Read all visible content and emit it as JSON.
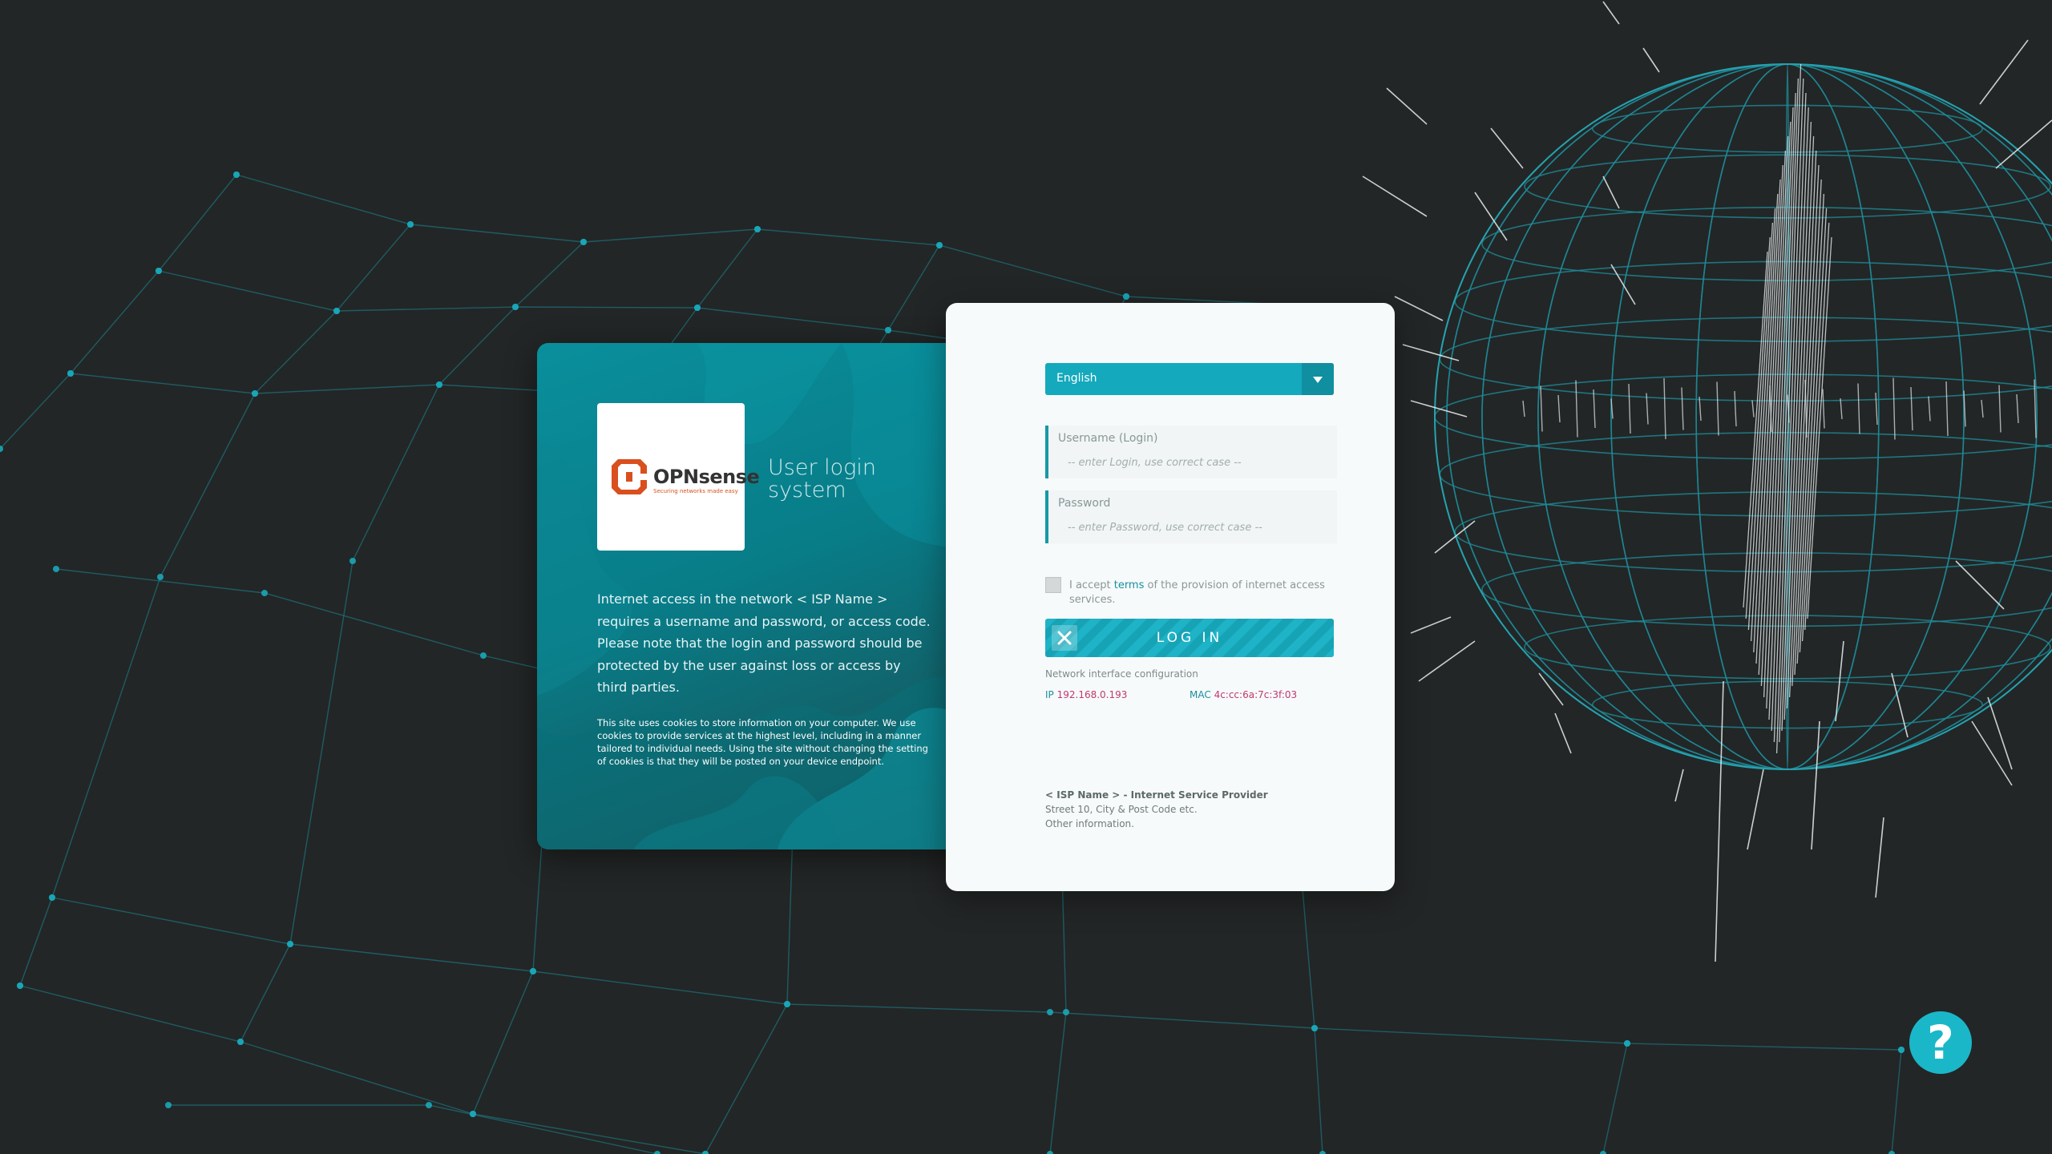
{
  "brand": {
    "logo_name": "OPNsense",
    "logo_tagline": "Securing networks made easy",
    "accent_color": "#14a9bd",
    "logo_color": "#d94f1e"
  },
  "info_card": {
    "title": "User login system",
    "description": "Internet access in the network < ISP Name > requires a username and password, or access code. Please note that the login and password should be protected by the user against loss or access by third parties.",
    "cookie_notice": "This site uses cookies to store information on your computer. We use cookies to provide services at the highest level, including in a manner tailored to individual needs. Using the site without changing the setting of cookies is that they will be posted on your device endpoint."
  },
  "login": {
    "language": {
      "selected": "English",
      "icon": "chevron-down-icon"
    },
    "username": {
      "label": "Username (Login)",
      "placeholder": "-- enter Login, use correct case --",
      "value": ""
    },
    "password": {
      "label": "Password",
      "placeholder": "-- enter Password, use correct case --",
      "value": ""
    },
    "terms": {
      "prefix": "I accept ",
      "link": "terms",
      "suffix": " of the provision of internet access services.",
      "checked": false
    },
    "login_button": "LOG IN"
  },
  "network": {
    "title": "Network interface configuration",
    "ip_label": "IP",
    "ip": "192.168.0.193",
    "mac_label": "MAC",
    "mac": "4c:cc:6a:7c:3f:03"
  },
  "footer": {
    "isp_name": "< ISP Name > - Internet Service Provider",
    "address": "Street 10, City & Post Code etc.",
    "other": "Other information."
  },
  "help": {
    "label": "?",
    "icon": "help-icon"
  }
}
